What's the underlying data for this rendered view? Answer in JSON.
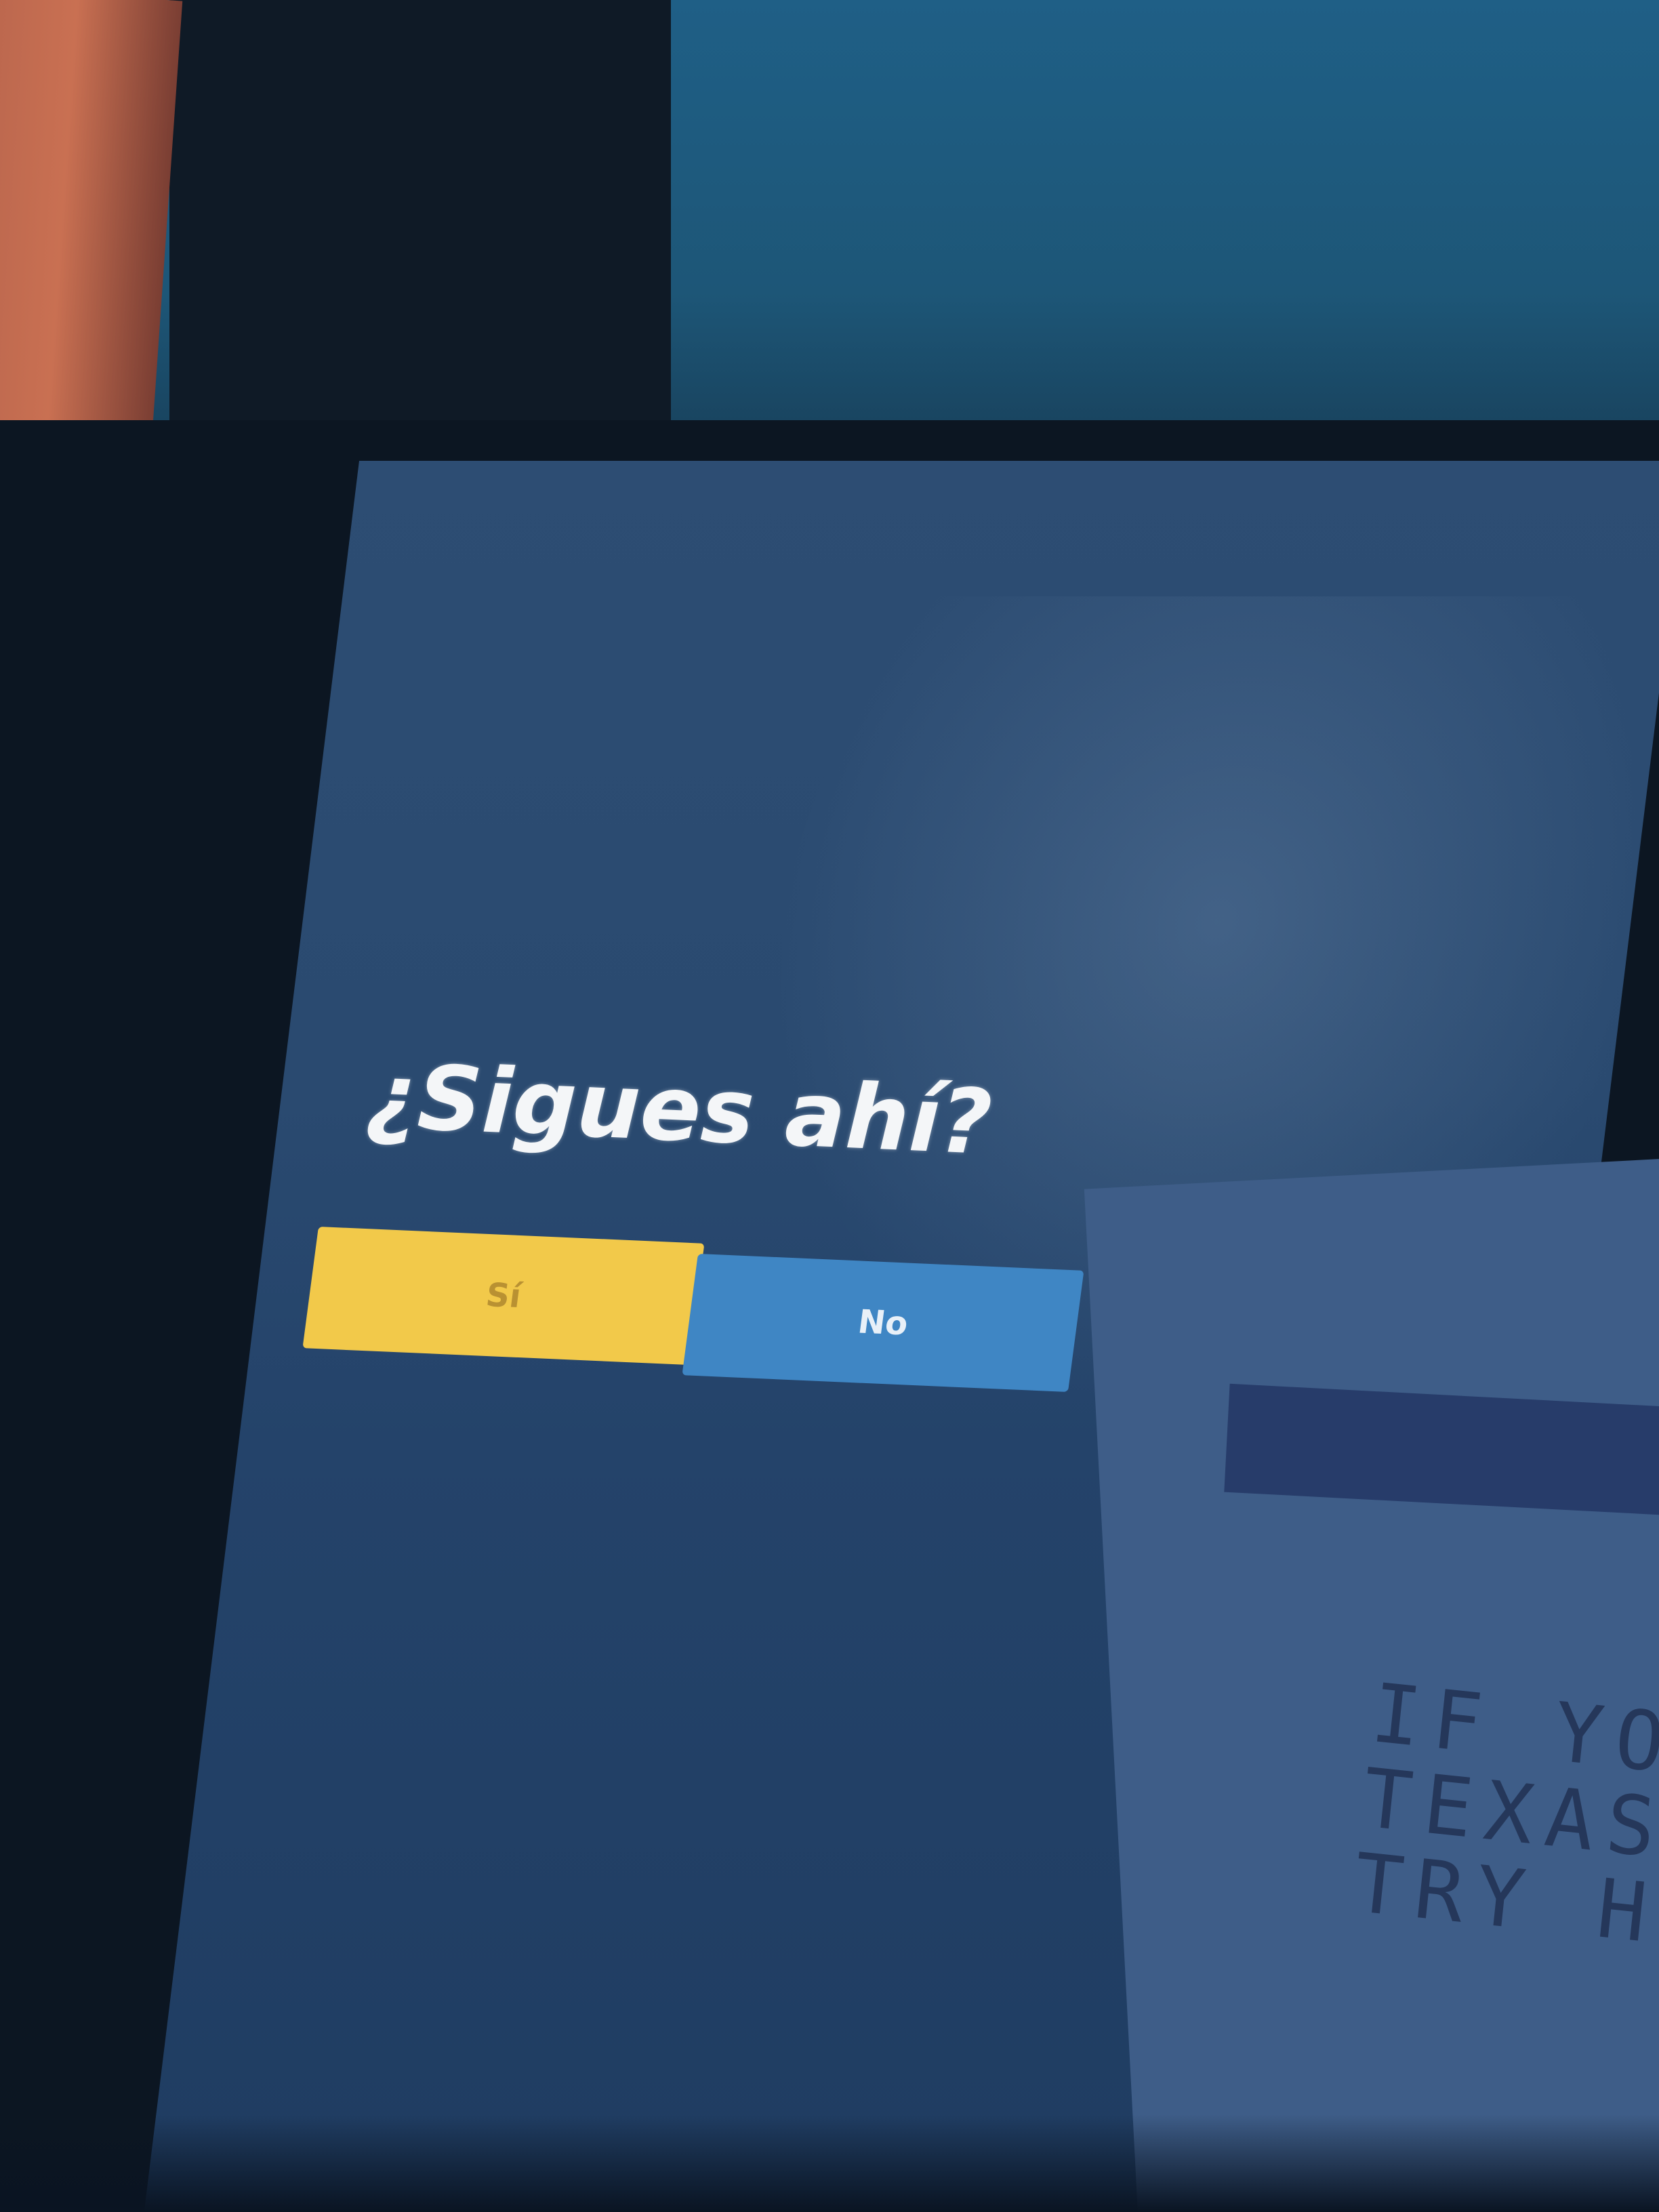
{
  "dialog": {
    "title": "¿Sigues ahí?",
    "yes_label": "Sí",
    "no_label": "No"
  },
  "poster": {
    "text": "IF YOU\nTEXAS\nTRY HE"
  },
  "colors": {
    "yes_button": "#f2c94a",
    "no_button": "#3f86c4",
    "screen_background": "#2a4a70"
  }
}
